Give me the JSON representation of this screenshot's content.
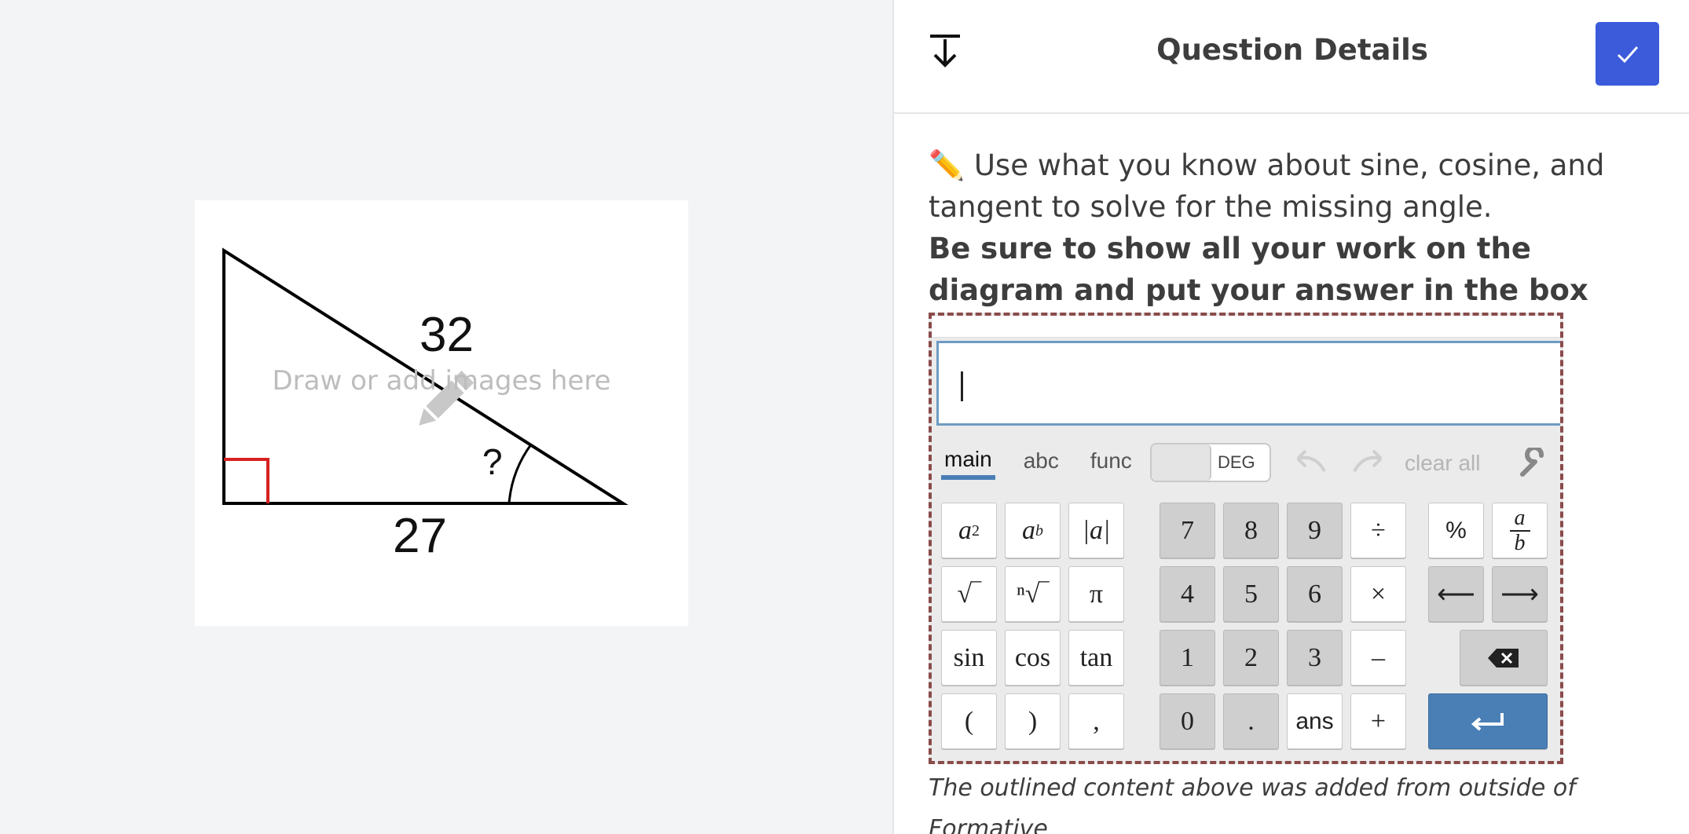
{
  "canvas": {
    "label_hypotenuse": "32",
    "label_base": "27",
    "label_unknown": "?",
    "draw_hint": "Draw or add images here"
  },
  "panel": {
    "title": "Question Details",
    "collapse_icon": "collapse-down-icon",
    "done_icon": "check-icon",
    "accent": "#3b5bdb"
  },
  "question": {
    "emoji": "✏️",
    "prompt": " Use what you know about sine, cosine, and tangent to solve for the missing angle.",
    "instruction": "Be sure to show all your work on the diagram and put your answer in the box below."
  },
  "keyboard": {
    "tabs": [
      "main",
      "abc",
      "func"
    ],
    "active_tab": "main",
    "angle_mode": "DEG",
    "clear_all": "clear all",
    "keys": {
      "a_sq_base": "a",
      "a_sq_exp": "2",
      "a_b_base": "a",
      "a_b_exp": "b",
      "abs": "|a|",
      "seven": "7",
      "eight": "8",
      "nine": "9",
      "divide": "÷",
      "percent": "%",
      "frac_num": "a",
      "frac_den": "b",
      "sqrt": "√‾",
      "nthroot": "ⁿ√‾",
      "pi": "π",
      "four": "4",
      "five": "5",
      "six": "6",
      "times": "×",
      "left": "⟵",
      "right": "⟶",
      "sin": "sin",
      "cos": "cos",
      "tan": "tan",
      "one": "1",
      "two": "2",
      "three": "3",
      "minus": "–",
      "lparen": "(",
      "rparen": ")",
      "comma": ",",
      "zero": "0",
      "dot": ".",
      "ans": "ans",
      "plus": "+"
    }
  },
  "footnote": "The outlined content above was added from outside of Formative"
}
